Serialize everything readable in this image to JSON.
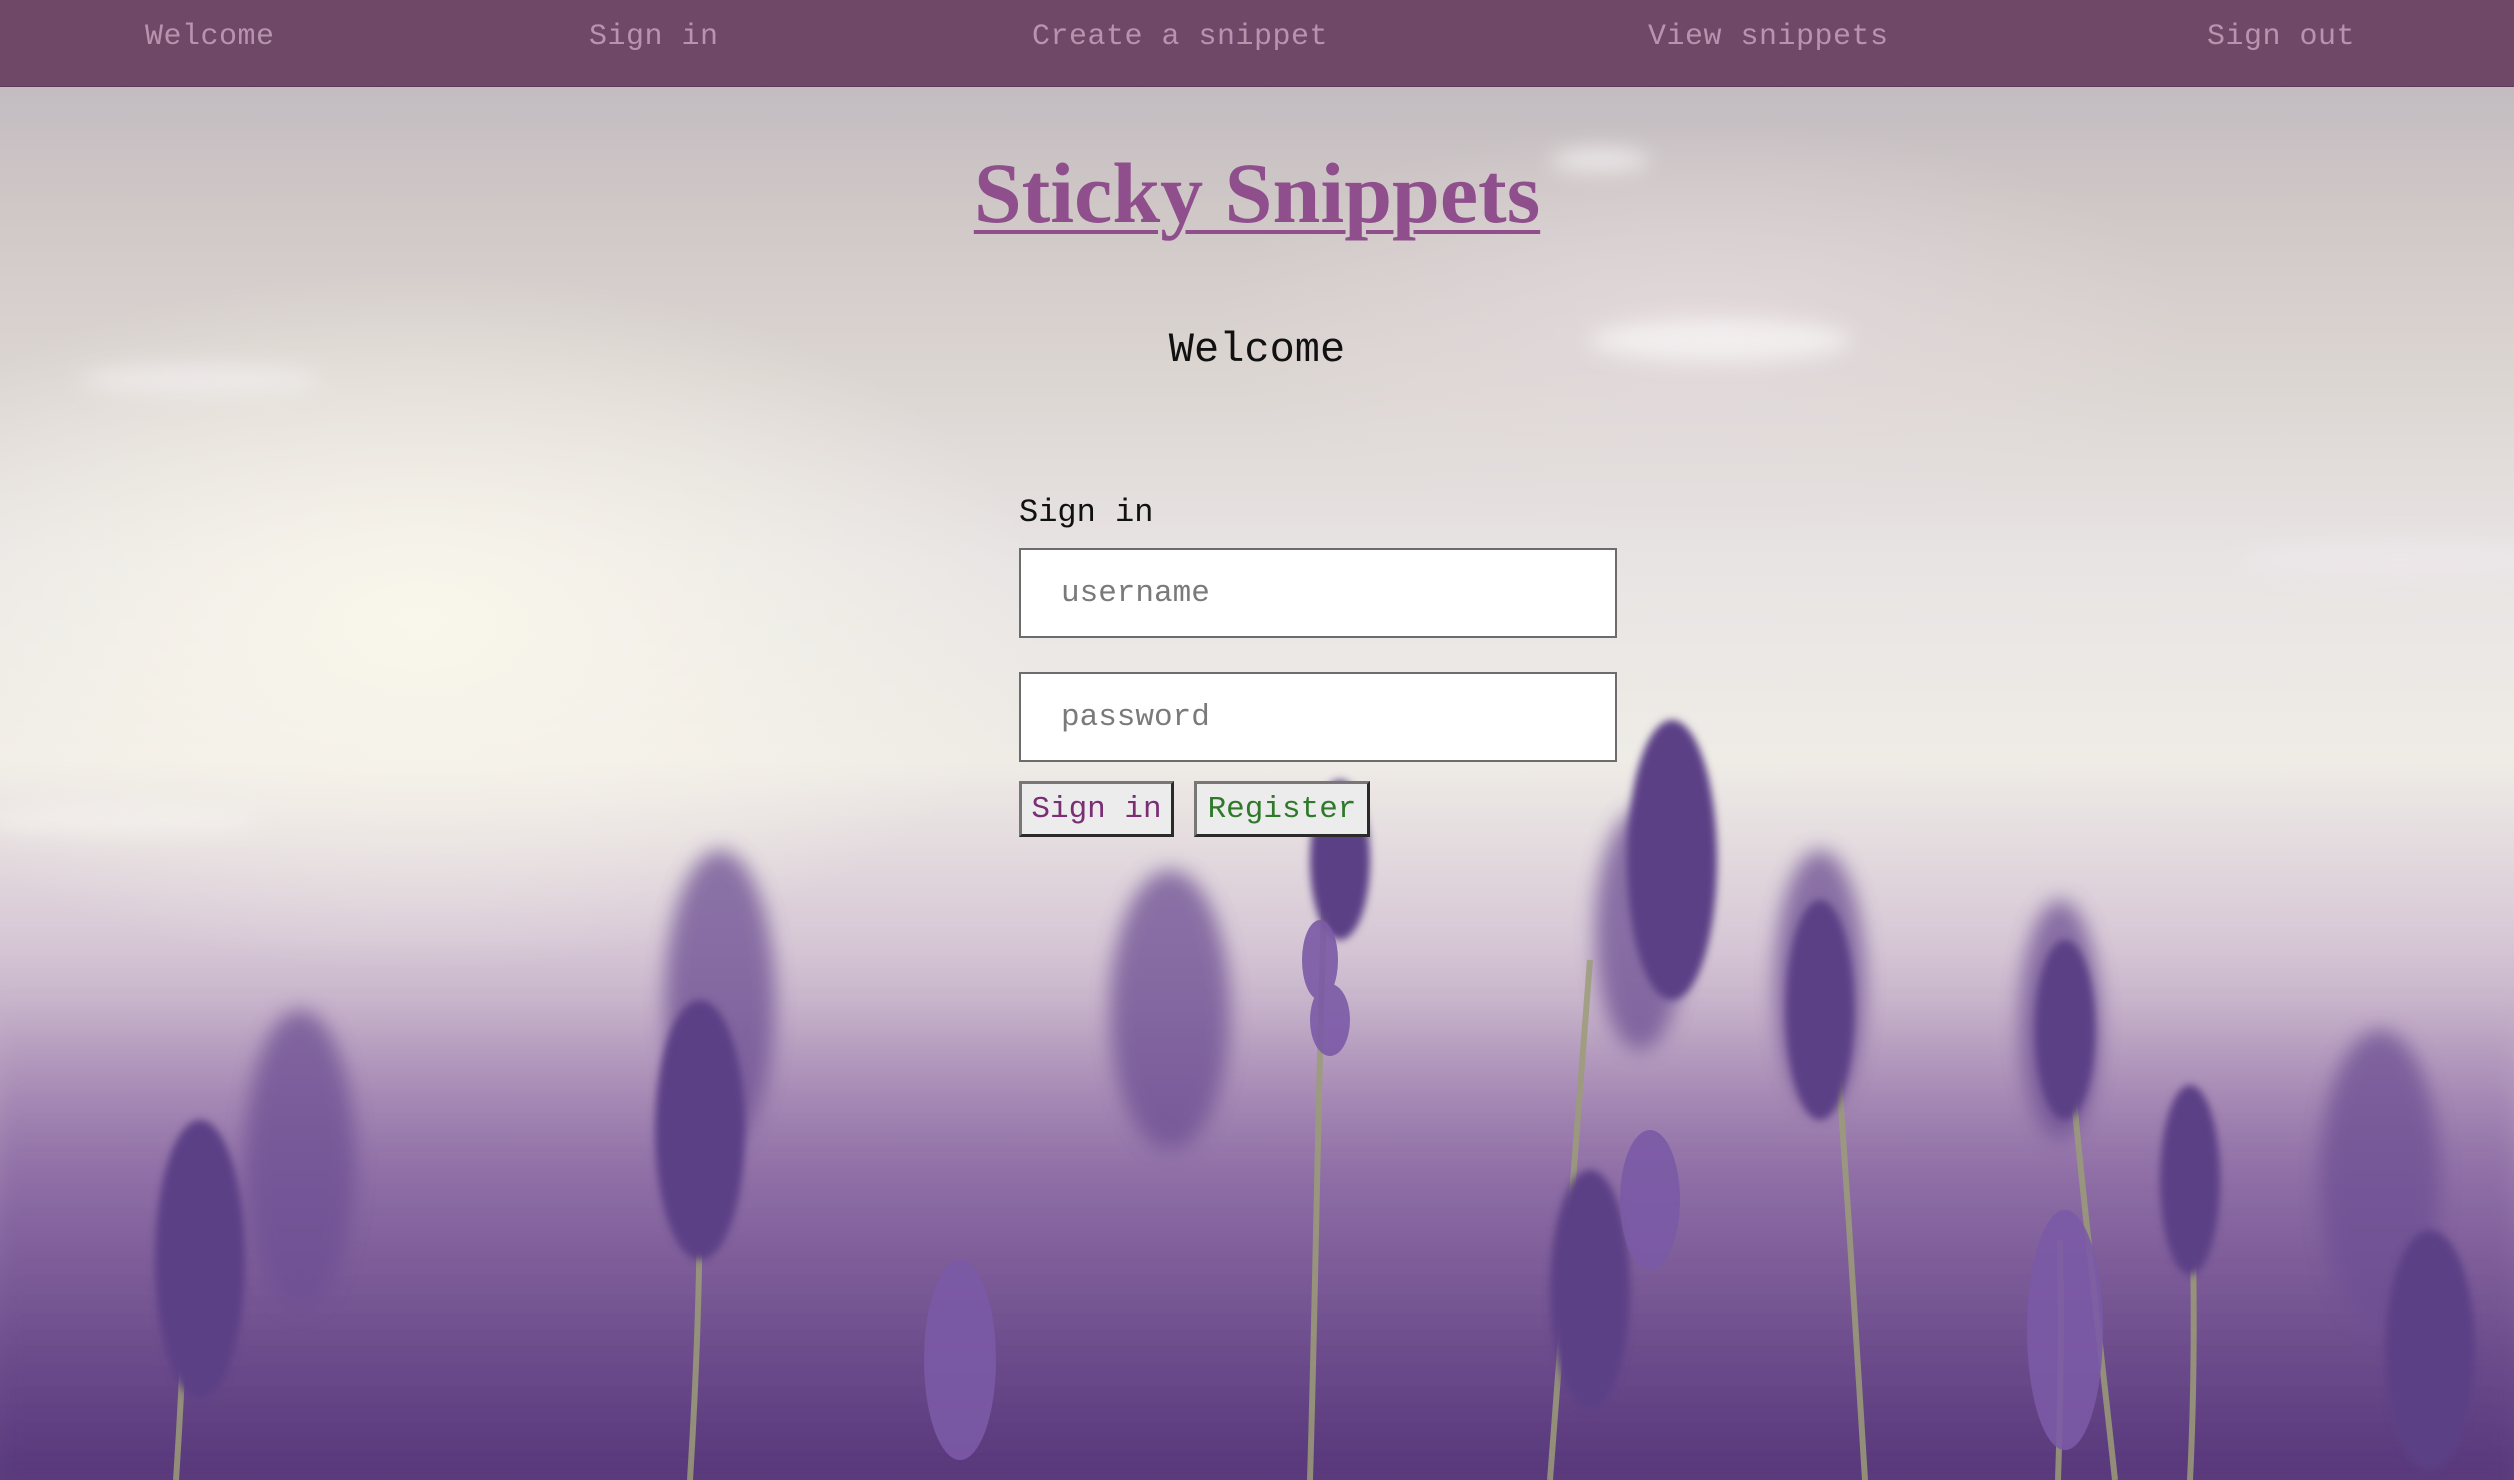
{
  "nav": {
    "items": [
      {
        "label": "Welcome"
      },
      {
        "label": "Sign in"
      },
      {
        "label": "Create a snippet"
      },
      {
        "label": "View snippets"
      },
      {
        "label": "Sign out"
      }
    ]
  },
  "site": {
    "title": "Sticky Snippets"
  },
  "page": {
    "heading": "Welcome"
  },
  "signin_form": {
    "label": "Sign in",
    "username_placeholder": "username",
    "password_placeholder": "password",
    "signin_button": "Sign in",
    "register_button": "Register"
  },
  "colors": {
    "navbar_bg": "#6f4868",
    "nav_text": "#b793ad",
    "title": "#8e4f8c",
    "signin_button_text": "#7a2e74",
    "register_button_text": "#2f7a2a"
  },
  "background": {
    "icon": "lavender-field-photo"
  }
}
